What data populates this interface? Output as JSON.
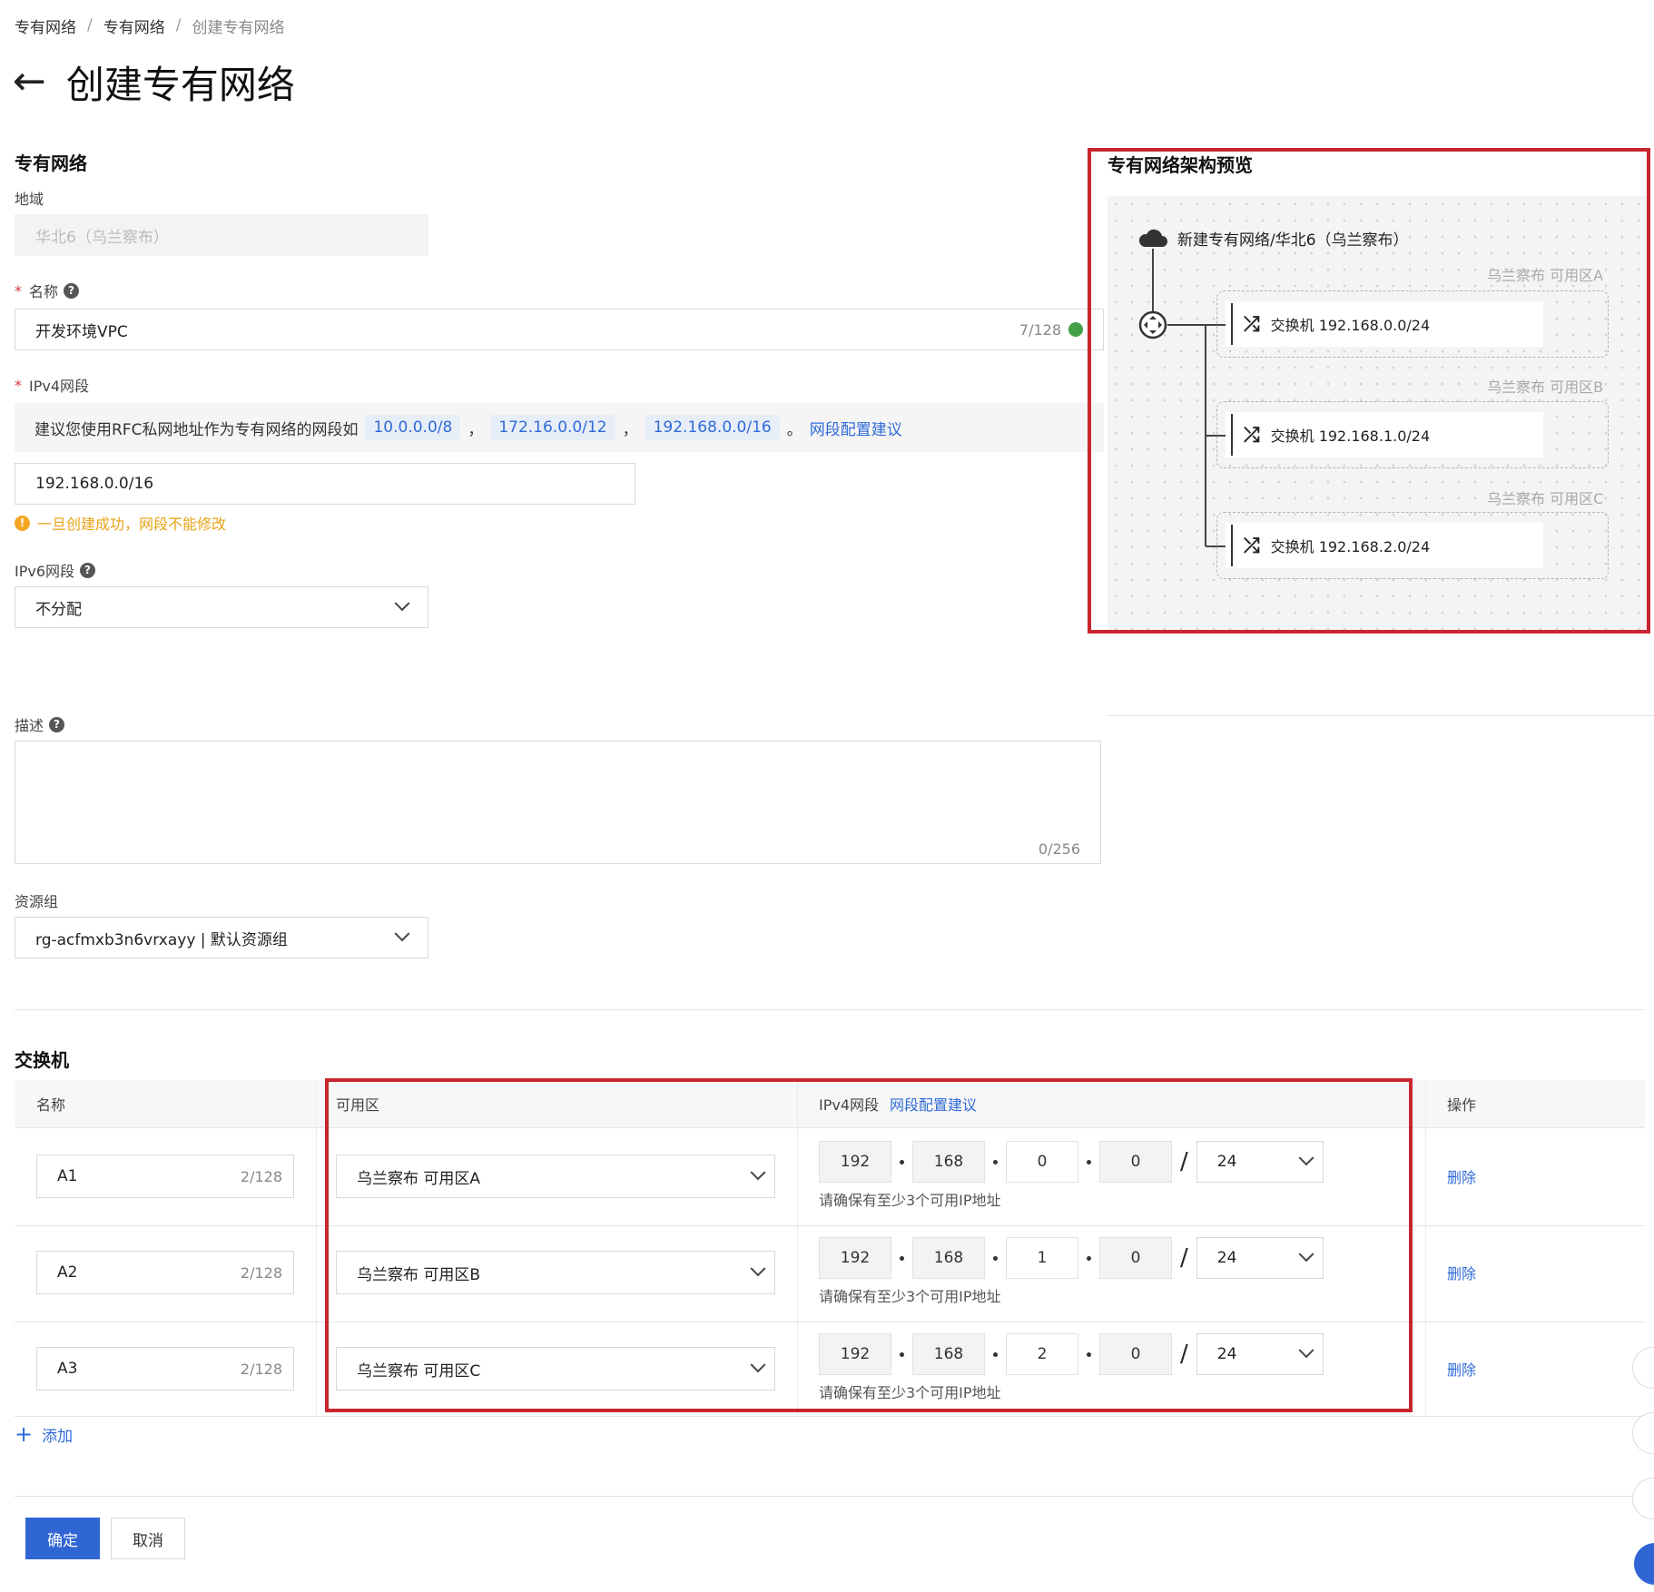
{
  "breadcrumb": [
    "专有网络",
    "专有网络",
    "创建专有网络"
  ],
  "page_title": "创建专有网络",
  "vpc_section": {
    "heading": "专有网络",
    "region_label": "地域",
    "region_value": "华北6（乌兰察布）",
    "name_label": "名称",
    "name_value": "开发环境VPC",
    "name_count": "7/128",
    "ipv4_label": "IPv4网段",
    "ipv4_tip": "建议您使用RFC私网地址作为专有网络的网段如",
    "ipv4_tags": [
      "10.0.0.0/8",
      "172.16.0.0/12",
      "192.168.0.0/16"
    ],
    "ipv4_comma": "，",
    "ipv4_period": "。",
    "ipv4_advice_link": "网段配置建议",
    "ipv4_value": "192.168.0.0/16",
    "ipv4_warning": "一旦创建成功，网段不能修改",
    "ipv6_label": "IPv6网段",
    "ipv6_value": "不分配",
    "desc_label": "描述",
    "desc_count": "0/256",
    "rg_label": "资源组",
    "rg_value": "rg-acfmxb3n6vrxayy | 默认资源组"
  },
  "preview": {
    "heading": "专有网络架构预览",
    "vpc_name": "新建专有网络/华北6（乌兰察布）",
    "zones": [
      {
        "label": "乌兰察布 可用区A",
        "switch": "交换机 192.168.0.0/24"
      },
      {
        "label": "乌兰察布 可用区B",
        "switch": "交换机 192.168.1.0/24"
      },
      {
        "label": "乌兰察布 可用区C",
        "switch": "交换机 192.168.2.0/24"
      }
    ]
  },
  "switch_section": {
    "heading": "交换机",
    "col_name": "名称",
    "col_zone": "可用区",
    "col_ipv4": "IPv4网段",
    "col_ipv4_link": "网段配置建议",
    "col_action": "操作",
    "rows": [
      {
        "name": "A1",
        "count": "2/128",
        "zone": "乌兰察布 可用区A",
        "o1": "192",
        "o2": "168",
        "o3": "0",
        "o4": "0",
        "mask": "24",
        "hint": "请确保有至少3个可用IP地址",
        "action": "删除"
      },
      {
        "name": "A2",
        "count": "2/128",
        "zone": "乌兰察布 可用区B",
        "o1": "192",
        "o2": "168",
        "o3": "1",
        "o4": "0",
        "mask": "24",
        "hint": "请确保有至少3个可用IP地址",
        "action": "删除"
      },
      {
        "name": "A3",
        "count": "2/128",
        "zone": "乌兰察布 可用区C",
        "o1": "192",
        "o2": "168",
        "o3": "2",
        "o4": "0",
        "mask": "24",
        "hint": "请确保有至少3个可用IP地址",
        "action": "删除"
      }
    ],
    "add_label": "添加"
  },
  "footer": {
    "confirm": "确定",
    "cancel": "取消"
  },
  "colors": {
    "accent": "#2f66d4",
    "highlight_border": "#c8262e",
    "warning": "#f5a623"
  }
}
